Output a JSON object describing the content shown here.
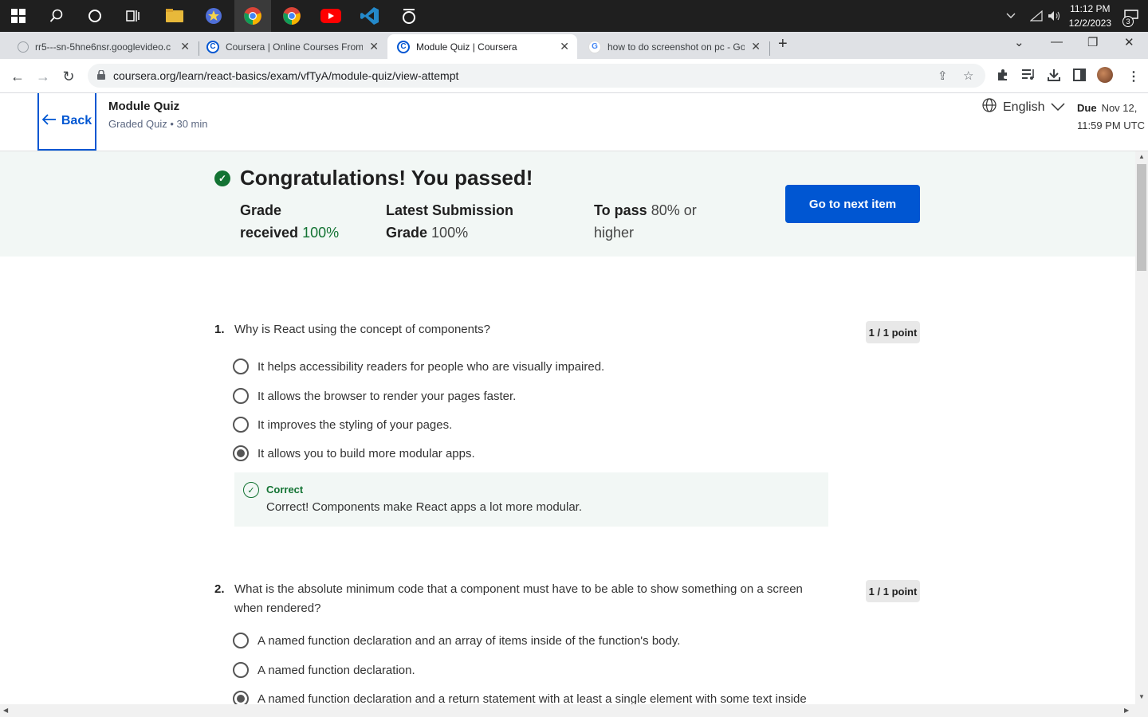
{
  "taskbar": {
    "time": "11:12 PM",
    "date": "12/2/2023",
    "notification_count": "3"
  },
  "browser": {
    "tabs": [
      {
        "title": "rr5---sn-5hne6nsr.googlevideo.c",
        "favicon": "globe-icon"
      },
      {
        "title": "Coursera | Online Courses From",
        "favicon": "coursera-icon"
      },
      {
        "title": "Module Quiz | Coursera",
        "favicon": "coursera-icon"
      },
      {
        "title": "how to do screenshot on pc - Go",
        "favicon": "google-icon"
      }
    ],
    "url": "coursera.org/learn/react-basics/exam/vfTyA/module-quiz/view-attempt"
  },
  "header": {
    "back_label": "Back",
    "title": "Module Quiz",
    "subtitle": "Graded Quiz • 30 min",
    "language": "English",
    "due_label": "Due",
    "due_line1": "Nov 12,",
    "due_line2": "11:59 PM UTC"
  },
  "result": {
    "title": "Congratulations! You passed!",
    "grade_label_1": "Grade",
    "grade_label_2": "received",
    "grade_value": "100%",
    "latest_label_1": "Latest Submission",
    "latest_label_2": "Grade",
    "latest_value": "100%",
    "pass_label": "To pass",
    "pass_value_1": "80% or",
    "pass_value_2": "higher",
    "next_button": "Go to next item"
  },
  "questions": [
    {
      "number": "1.",
      "text": "Why is React using the concept of components?",
      "points": "1 / 1 point",
      "options": [
        {
          "label": "It helps accessibility readers for people who are visually impaired.",
          "selected": false
        },
        {
          "label": "It allows the browser to render your pages faster.",
          "selected": false
        },
        {
          "label": "It improves the styling of your pages.",
          "selected": false
        },
        {
          "label": "It allows you to build more modular apps.",
          "selected": true
        }
      ],
      "feedback_label": "Correct",
      "feedback_text": "Correct! Components make React apps a lot more modular."
    },
    {
      "number": "2.",
      "text": "What is the absolute minimum code that a component must have to be able to show something on a screen when rendered?",
      "points": "1 / 1 point",
      "options": [
        {
          "label": "A named function declaration and an array of items inside of the function's body.",
          "selected": false
        },
        {
          "label": "A named function declaration.",
          "selected": false
        },
        {
          "label": "A named function declaration and a return statement with at least a single element with some text inside",
          "selected": true
        }
      ]
    }
  ]
}
